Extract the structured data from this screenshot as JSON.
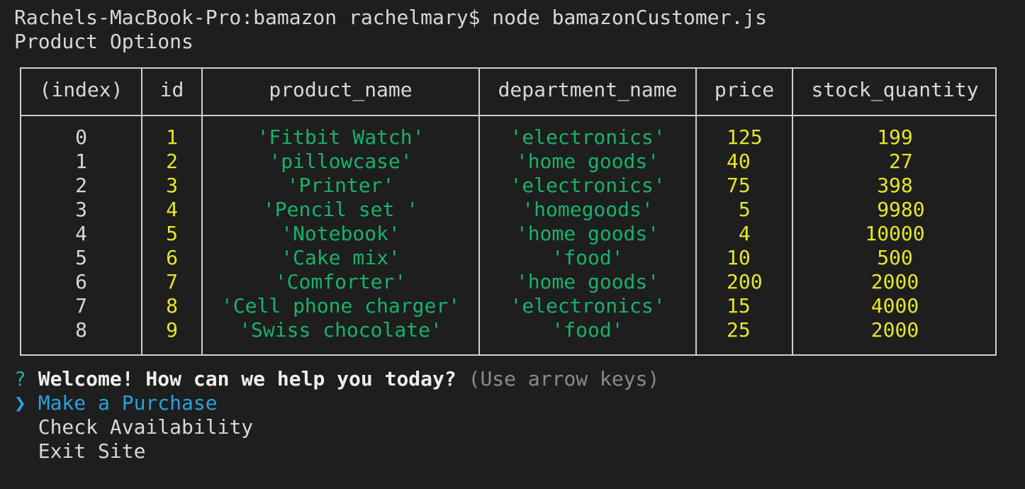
{
  "terminal": {
    "prompt": "Rachels-MacBook-Pro:bamazon rachelmary$ node bamazonCustomer.js",
    "heading": "Product Options"
  },
  "table": {
    "headers": [
      "(index)",
      "id",
      "product_name",
      "department_name",
      "price",
      "stock_quantity"
    ],
    "rows": [
      {
        "index": "0",
        "id": "1",
        "product_name": "'Fitbit Watch'",
        "department_name": "'electronics'",
        "price": "125",
        "stock_quantity": "199"
      },
      {
        "index": "1",
        "id": "2",
        "product_name": "'pillowcase'",
        "department_name": "'home goods'",
        "price": "40",
        "stock_quantity": " 27"
      },
      {
        "index": "2",
        "id": "3",
        "product_name": "'Printer'",
        "department_name": "'electronics'",
        "price": "75",
        "stock_quantity": "398"
      },
      {
        "index": "3",
        "id": "4",
        "product_name": "'Pencil set '",
        "department_name": "'homegoods'",
        "price": " 5",
        "stock_quantity": " 9980"
      },
      {
        "index": "4",
        "id": "5",
        "product_name": "'Notebook'",
        "department_name": "'home goods'",
        "price": " 4",
        "stock_quantity": "10000"
      },
      {
        "index": "5",
        "id": "6",
        "product_name": "'Cake mix'",
        "department_name": "'food'",
        "price": "10",
        "stock_quantity": "500"
      },
      {
        "index": "6",
        "id": "7",
        "product_name": "'Comforter'",
        "department_name": "'home goods'",
        "price": "200",
        "stock_quantity": "2000"
      },
      {
        "index": "7",
        "id": "8",
        "product_name": "'Cell phone charger'",
        "department_name": "'electronics'",
        "price": "15",
        "stock_quantity": "4000"
      },
      {
        "index": "8",
        "id": "9",
        "product_name": "'Swiss chocolate'",
        "department_name": "'food'",
        "price": "25",
        "stock_quantity": "2000"
      }
    ]
  },
  "question": {
    "mark": "?",
    "text": "Welcome! How can we help you today?",
    "hint": "(Use arrow keys)"
  },
  "menu": {
    "pointer": "❯",
    "options": [
      "Make a Purchase",
      "Check Availability",
      "Exit Site"
    ],
    "selected_index": 0
  },
  "colors": {
    "background": "#1e1e1e",
    "string": "#17b26a",
    "number": "#e6e62a",
    "selected": "#27a3dd"
  }
}
